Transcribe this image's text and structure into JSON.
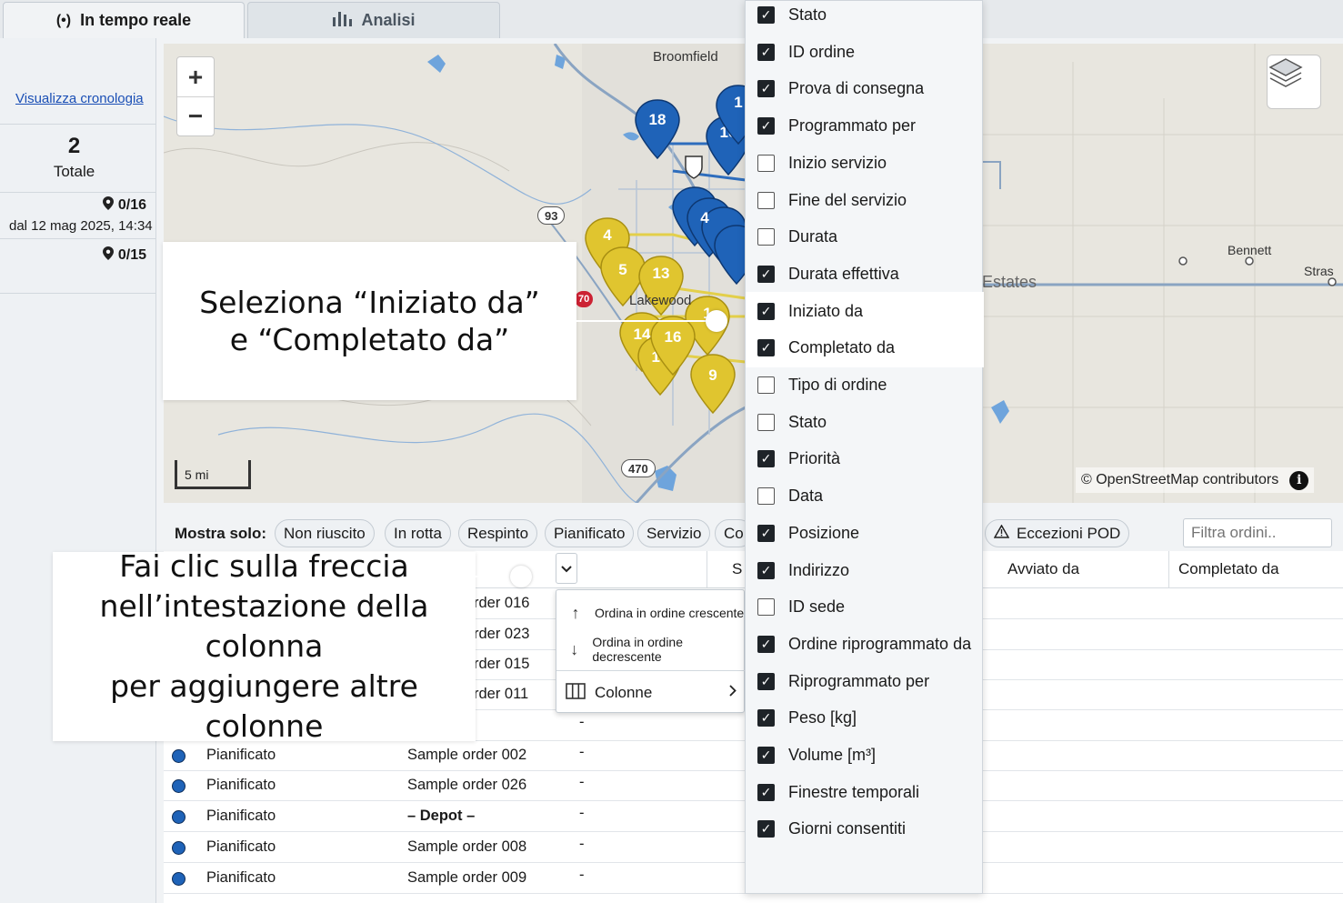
{
  "tabs": [
    {
      "label": "In tempo reale",
      "icon": "broadcast-icon",
      "active": true
    },
    {
      "label": "Analisi",
      "icon": "bar-chart-icon",
      "active": false
    }
  ],
  "left_panel": {
    "history_link": "Visualizza cronologia",
    "total_count": "2",
    "total_label": "Totale",
    "stop_progress_1": "0/16",
    "since_text": "dal 12 mag 2025, 14:34",
    "stop_progress_2": "0/15"
  },
  "map": {
    "zoom_in": "+",
    "zoom_out": "−",
    "scale_label": "5 mi",
    "attribution": "© OpenStreetMap contributors",
    "info_symbol": "i",
    "place_labels": {
      "broomfield": "Broomfield",
      "lakewood": "Lakewood",
      "estates": "Estates",
      "bennett": "Bennett",
      "stras": "Stras"
    },
    "road_shields": {
      "r93": "93",
      "r470": "470",
      "r70": "70"
    },
    "markers_blue": [
      "18",
      "16",
      "1",
      "4"
    ],
    "markers_yellow": [
      "4",
      "5",
      "13",
      "14",
      "16",
      "15",
      "9",
      "1"
    ]
  },
  "filters": {
    "title": "Mostra solo:",
    "chips": [
      "Non riuscito",
      "In rotta",
      "Respinto",
      "Pianificato",
      "Servizio",
      "Co"
    ],
    "pod_chip": "Eccezioni POD",
    "search_placeholder": "Filtra ordini.."
  },
  "table": {
    "header_partial": "S",
    "col_started_by": "Avviato da",
    "col_completed_by": "Completato da",
    "partial_orders": [
      "rder 016",
      "rder 023",
      "rder 015",
      "rder 011"
    ],
    "rows": [
      {
        "status": "Pianificato",
        "order": "Sample order 002",
        "value": "-"
      },
      {
        "status": "Pianificato",
        "order": "Sample order 026",
        "value": "-"
      },
      {
        "status": "Pianificato",
        "order": "– Depot –",
        "value": "-"
      },
      {
        "status": "Pianificato",
        "order": "Sample order 008",
        "value": "-"
      },
      {
        "status": "Pianificato",
        "order": "Sample order 009",
        "value": "-"
      }
    ],
    "stray_dash": "-"
  },
  "context_menu": {
    "sort_asc": "Ordina in ordine crescente",
    "sort_desc": "Ordina in ordine decrescente",
    "columns": "Colonne"
  },
  "columns_panel": {
    "items": [
      {
        "label": "Stato",
        "checked": true
      },
      {
        "label": "ID ordine",
        "checked": true
      },
      {
        "label": "Prova di consegna",
        "checked": true
      },
      {
        "label": "Programmato per",
        "checked": true
      },
      {
        "label": "Inizio servizio",
        "checked": false
      },
      {
        "label": "Fine del servizio",
        "checked": false
      },
      {
        "label": "Durata",
        "checked": false
      },
      {
        "label": "Durata effettiva",
        "checked": true
      },
      {
        "label": "Iniziato da",
        "checked": true,
        "highlighted": true
      },
      {
        "label": "Completato da",
        "checked": true,
        "highlighted": true
      },
      {
        "label": "Tipo di ordine",
        "checked": false
      },
      {
        "label": "Stato",
        "checked": false
      },
      {
        "label": "Priorità",
        "checked": true
      },
      {
        "label": "Data",
        "checked": false
      },
      {
        "label": "Posizione",
        "checked": true
      },
      {
        "label": "Indirizzo",
        "checked": true
      },
      {
        "label": "ID sede",
        "checked": false
      },
      {
        "label": "Ordine riprogrammato da",
        "checked": true
      },
      {
        "label": "Riprogrammato per",
        "checked": true
      },
      {
        "label": "Peso [kg]",
        "checked": true
      },
      {
        "label": "Volume [m³]",
        "checked": true
      },
      {
        "label": "Finestre temporali",
        "checked": true
      },
      {
        "label": "Giorni consentiti",
        "checked": true
      }
    ]
  },
  "callouts": {
    "select_line1": "Seleziona “Iniziato da”",
    "select_line2": "e “Completato da”",
    "click_line1": "Fai clic sulla freccia",
    "click_line2": "nell’intestazione della colonna",
    "click_line3": "per aggiungere altre colonne"
  },
  "colors": {
    "marker_blue": "#1f63b8",
    "marker_yellow": "#e0c52f",
    "checkbox_on": "#1e2328",
    "link": "#1a4fb5"
  }
}
